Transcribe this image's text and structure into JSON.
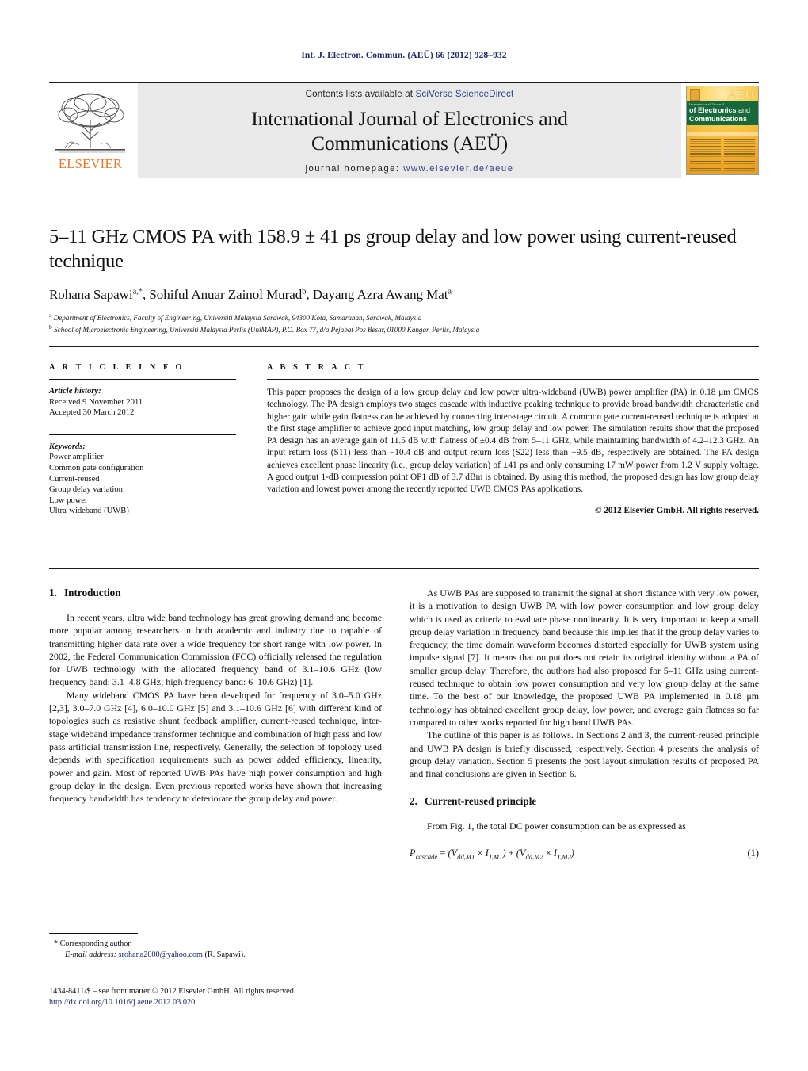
{
  "running_head": "Int. J. Electron. Commun. (AEÜ) 66 (2012) 928–932",
  "masthead": {
    "contents_prefix": "Contents lists available at ",
    "contents_link": "SciVerse ScienceDirect",
    "journal_title_line1": "International Journal of Electronics and",
    "journal_title_line2": "Communications (AEÜ)",
    "homepage_prefix": "journal homepage:",
    "homepage_link": "www.elsevier.de/aeue",
    "publisher_logo_text": "ELSEVIER",
    "cover": {
      "aeu_mark": "AEU",
      "band_kicker": "International Journal",
      "band_line1_bold": "of Electronics",
      "band_line1_thin": "and",
      "band_line2": "Communications"
    }
  },
  "article": {
    "title": "5–11 GHz CMOS PA with 158.9 ± 41 ps group delay and low power using current-reused technique",
    "authors": [
      {
        "name": "Rohana Sapawi",
        "sup": "a",
        "star": true
      },
      {
        "name": "Sohiful Anuar Zainol Murad",
        "sup": "b",
        "star": false
      },
      {
        "name": "Dayang Azra Awang Mat",
        "sup": "a",
        "star": false
      }
    ],
    "affiliations": [
      {
        "mark": "a",
        "text": "Department of Electronics, Faculty of Engineering, Universiti Malaysia Sarawak, 94300 Kota, Samarahan, Sarawak, Malaysia"
      },
      {
        "mark": "b",
        "text": "School of Microelectronic Engineering, Universiti Malaysia Perlis (UniMAP), P.O. Box 77, d/a Pejabat Pos Besar, 01000 Kangar, Perlis, Malaysia"
      }
    ]
  },
  "article_info": {
    "heading": "A R T I C L E   I N F O",
    "history_label": "Article history:",
    "history": [
      "Received 9 November 2011",
      "Accepted 30 March 2012"
    ],
    "keywords_label": "Keywords:",
    "keywords": [
      "Power amplifier",
      "Common gate configuration",
      "Current-reused",
      "Group delay variation",
      "Low power",
      "Ultra-wideband (UWB)"
    ]
  },
  "abstract": {
    "heading": "A B S T R A C T",
    "text": "This paper proposes the design of a low group delay and low power ultra-wideband (UWB) power amplifier (PA) in 0.18 μm CMOS technology. The PA design employs two stages cascade with inductive peaking technique to provide broad bandwidth characteristic and higher gain while gain flatness can be achieved by connecting inter-stage circuit. A common gate current-reused technique is adopted at the first stage amplifier to achieve good input matching, low group delay and low power. The simulation results show that the proposed PA design has an average gain of 11.5 dB with flatness of ±0.4 dB from 5–11 GHz, while maintaining bandwidth of 4.2–12.3 GHz. An input return loss (S11) less than −10.4 dB and output return loss (S22) less than −9.5 dB, respectively are obtained. The PA design achieves excellent phase linearity (i.e., group delay variation) of ±41 ps and only consuming 17 mW power from 1.2 V supply voltage. A good output 1-dB compression point OP1 dB of 3.7 dBm is obtained. By using this method, the proposed design has low group delay variation and lowest power among the recently reported UWB CMOS PAs applications.",
    "copyright": "© 2012 Elsevier GmbH. All rights reserved."
  },
  "sections": {
    "introduction": {
      "number": "1.",
      "title": "Introduction",
      "paragraph1": "In recent years, ultra wide band technology has great growing demand and become more popular among researchers in both academic and industry due to capable of transmitting higher data rate over a wide frequency for short range with low power. In 2002, the Federal Communication Commission (FCC) officially released the regulation for UWB technology with the allocated frequency band of 3.1–10.6 GHz (low frequency band: 3.1–4.8 GHz; high frequency band: 6–10.6 GHz) [1].",
      "paragraph2": "Many wideband CMOS PA have been developed for frequency of 3.0–5.0 GHz [2,3], 3.0–7.0 GHz [4], 6.0–10.0 GHz [5] and 3.1–10.6 GHz [6] with different kind of topologies such as resistive shunt feedback amplifier, current-reused technique, inter-stage wideband impedance transformer technique and combination of high pass and low pass artificial transmission line, respectively. Generally, the selection of topology used depends with specification requirements such as power added efficiency, linearity, power and gain. Most of reported UWB PAs have high power consumption and high group delay in the design. Even previous reported works have shown that increasing frequency bandwidth has tendency to deteriorate the group delay and power.",
      "paragraph3": "As UWB PAs are supposed to transmit the signal at short distance with very low power, it is a motivation to design UWB PA with low power consumption and low group delay which is used as criteria to evaluate phase nonlinearity. It is very important to keep a small group delay variation in frequency band because this implies that if the group delay varies to frequency, the time domain waveform becomes distorted especially for UWB system using impulse signal [7]. It means that output does not retain its original identity without a PA of smaller group delay. Therefore, the authors had also proposed for 5–11 GHz using current-reused technique to obtain low power consumption and very low group delay at the same time. To the best of our knowledge, the proposed UWB PA implemented in 0.18 μm technology has obtained excellent group delay, low power, and average gain flatness so far compared to other works reported for high band UWB PAs.",
      "paragraph4": "The outline of this paper is as follows. In Sections 2 and 3, the current-reused principle and UWB PA design is briefly discussed, respectively. Section 4 presents the analysis of group delay variation. Section 5 presents the post layout simulation results of proposed PA and final conclusions are given in Section 6."
    },
    "current_reused": {
      "number": "2.",
      "title": "Current-reused principle",
      "paragraph1": "From Fig. 1, the total DC power consumption can be as expressed as",
      "equation_number": "(1)"
    }
  },
  "footnote": {
    "corresponding": "* Corresponding author.",
    "email_label": "E-mail address:",
    "email": "srohana2000@yahoo.com",
    "email_suffix": "(R. Sapawi)."
  },
  "imprint": {
    "line1": "1434-8411/$ – see front matter © 2012 Elsevier GmbH. All rights reserved.",
    "doi": "http://dx.doi.org/10.1016/j.aeue.2012.03.020"
  },
  "colors": {
    "link_blue": "#1b2a6b",
    "elsevier_orange": "#e87722",
    "cover_green": "#17683a",
    "masthead_grey": "#e9e9e9"
  }
}
